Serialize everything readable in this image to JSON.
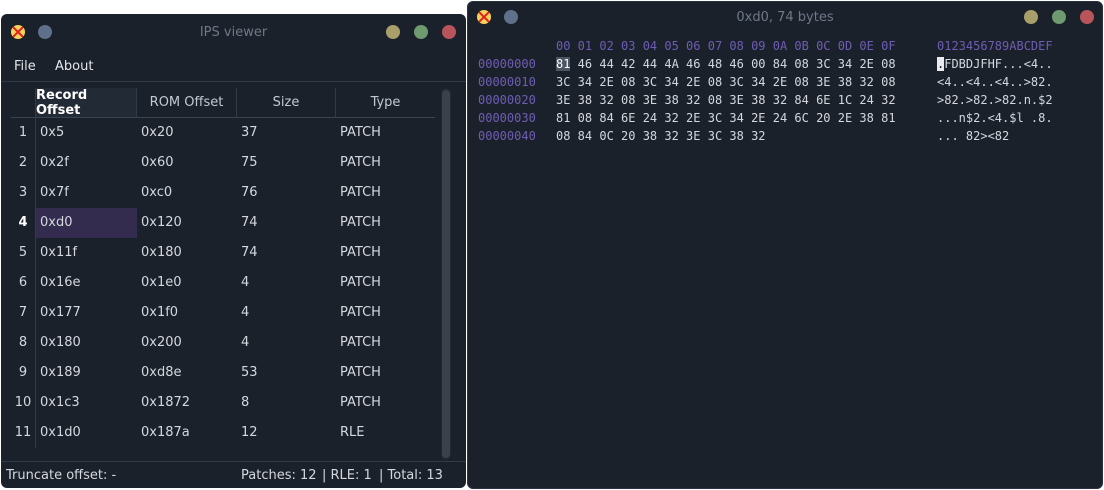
{
  "viewer": {
    "title": "IPS viewer",
    "menu": [
      "File",
      "About"
    ],
    "columns": [
      "Record Offset",
      "ROM Offset",
      "Size",
      "Type"
    ],
    "rows": [
      {
        "n": "1",
        "rec": "0x5",
        "rom": "0x20",
        "size": "37",
        "type": "PATCH"
      },
      {
        "n": "2",
        "rec": "0x2f",
        "rom": "0x60",
        "size": "75",
        "type": "PATCH"
      },
      {
        "n": "3",
        "rec": "0x7f",
        "rom": "0xc0",
        "size": "76",
        "type": "PATCH"
      },
      {
        "n": "4",
        "rec": "0xd0",
        "rom": "0x120",
        "size": "74",
        "type": "PATCH"
      },
      {
        "n": "5",
        "rec": "0x11f",
        "rom": "0x180",
        "size": "74",
        "type": "PATCH"
      },
      {
        "n": "6",
        "rec": "0x16e",
        "rom": "0x1e0",
        "size": "4",
        "type": "PATCH"
      },
      {
        "n": "7",
        "rec": "0x177",
        "rom": "0x1f0",
        "size": "4",
        "type": "PATCH"
      },
      {
        "n": "8",
        "rec": "0x180",
        "rom": "0x200",
        "size": "4",
        "type": "PATCH"
      },
      {
        "n": "9",
        "rec": "0x189",
        "rom": "0xd8e",
        "size": "53",
        "type": "PATCH"
      },
      {
        "n": "10",
        "rec": "0x1c3",
        "rom": "0x1872",
        "size": "8",
        "type": "PATCH"
      },
      {
        "n": "11",
        "rec": "0x1d0",
        "rom": "0x187a",
        "size": "12",
        "type": "RLE"
      }
    ],
    "selected_row": 3,
    "status": {
      "truncate": "Truncate offset:  -",
      "patches": "Patches:  12",
      "rle": "|  RLE:  1",
      "total": "|  Total:  13"
    }
  },
  "hexview": {
    "title": "0xd0, 74 bytes",
    "header_cols": "00 01 02 03 04 05 06 07 08 09 0A 0B 0C 0D 0E 0F",
    "header_ascii": "0123456789ABCDEF",
    "lines": [
      {
        "addr": "00000000",
        "first": "81",
        "bytes": " 46 44 42 44 4A 46 48 46 00 84 08 3C 34 2E 08",
        "afirst": ".",
        "ascii": "FDBDJFHF...<4.."
      },
      {
        "addr": "00000010",
        "first": "",
        "bytes": "3C 34 2E 08 3C 34 2E 08 3C 34 2E 08 3E 38 32 08",
        "afirst": "",
        "ascii": "<4..<4..<4..>82."
      },
      {
        "addr": "00000020",
        "first": "",
        "bytes": "3E 38 32 08 3E 38 32 08 3E 38 32 84 6E 1C 24 32",
        "afirst": "",
        "ascii": ">82.>82.>82.n.$2"
      },
      {
        "addr": "00000030",
        "first": "",
        "bytes": "81 08 84 6E 24 32 2E 3C 34 2E 24 6C 20 2E 38 81",
        "afirst": "",
        "ascii": "...n$2.<4.$l .8."
      },
      {
        "addr": "00000040",
        "first": "",
        "bytes": "08 84 0C 20 38 32 3E 3C 38 32",
        "afirst": "",
        "ascii": "... 82><82"
      }
    ]
  },
  "colors": {
    "background": "#1b212b",
    "accent": "#6e5db3",
    "selection": "#332c4f"
  }
}
